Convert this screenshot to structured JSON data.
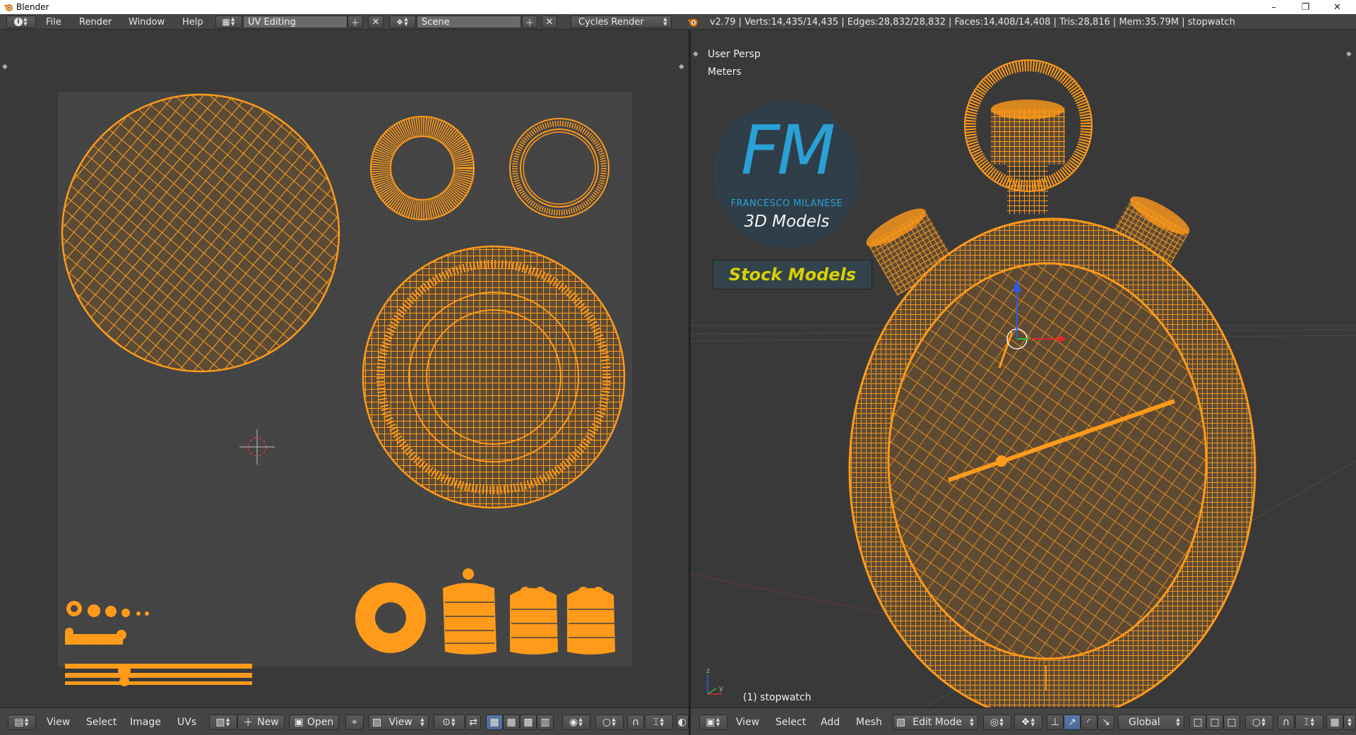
{
  "window": {
    "title": "Blender"
  },
  "info_bar": {
    "menus": [
      "File",
      "Render",
      "Window",
      "Help"
    ],
    "screen_layout": "UV Editing",
    "scene": "Scene",
    "render_engine": "Cycles Render",
    "stats": "v2.79 | Verts:14,435/14,435 | Edges:28,832/28,832 | Faces:14,408/14,408 | Tris:28,816 | Mem:35.79M | stopwatch"
  },
  "uv_editor": {
    "header_menus": [
      "View",
      "Select",
      "Image",
      "UVs"
    ],
    "new_label": "New",
    "open_label": "Open",
    "view_label": "View"
  },
  "viewport": {
    "view_name": "User Persp",
    "units": "Meters",
    "object_label": "(1) stopwatch",
    "header_menus": [
      "View",
      "Select",
      "Add",
      "Mesh"
    ],
    "mode": "Edit Mode",
    "orientation": "Global"
  },
  "logo": {
    "letters": "FM",
    "name": "FRANCESCO MILANESE",
    "tagline": "3D Models",
    "banner": "Stock Models"
  },
  "colors": {
    "wire": "#ff9a1a",
    "background": "#393939",
    "header": "#454545",
    "logo_blue": "#29a7e0",
    "banner_text": "#d8d000"
  }
}
